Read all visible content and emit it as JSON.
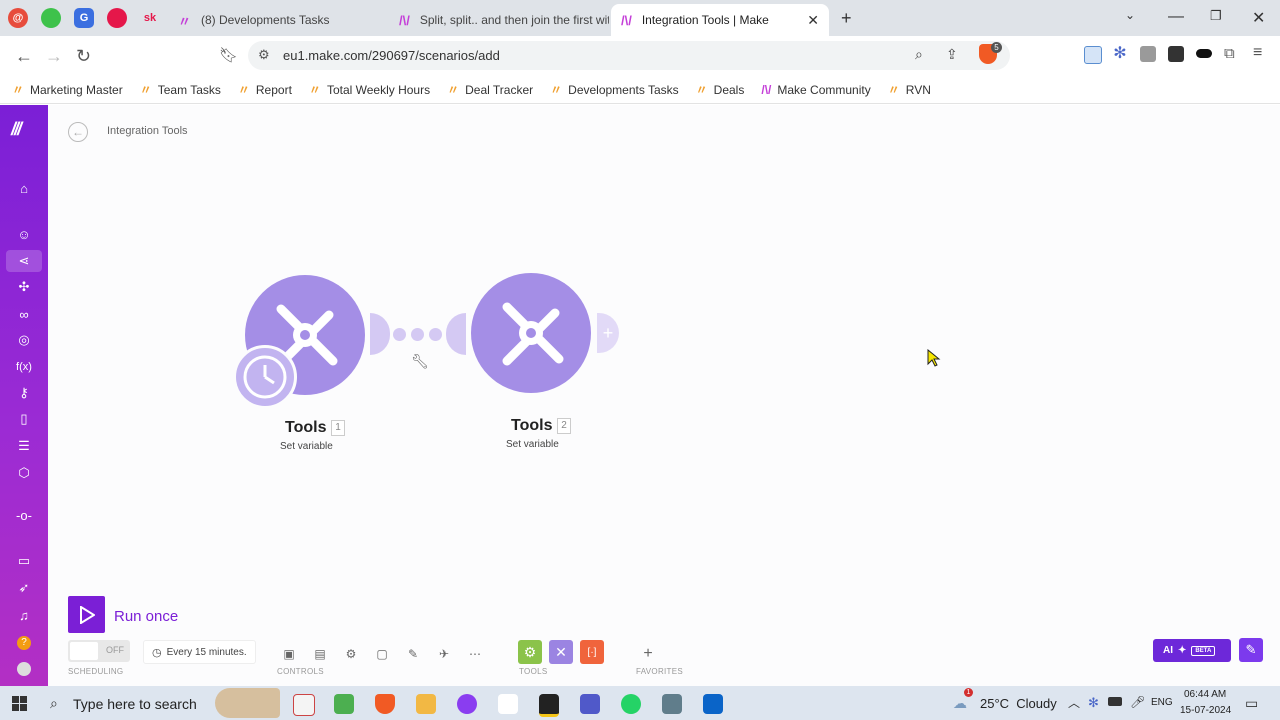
{
  "browser": {
    "tabs": [
      {
        "label": "(8) Developments Tasks",
        "active": false
      },
      {
        "label": "Split, split.. and then join the first wit",
        "active": false
      },
      {
        "label": "Integration Tools | Make",
        "active": true
      }
    ],
    "pinned_tab_text": "sk",
    "new_tab_label": "+",
    "url": "eu1.make.com/290697/scenarios/add",
    "brave_badge": "5"
  },
  "bookmarks": [
    "Marketing Master",
    "Team Tasks",
    "Report",
    "Total Weekly Hours",
    "Deal Tracker",
    "Developments Tasks",
    "Deals",
    "Make Community",
    "RVN"
  ],
  "scenario": {
    "breadcrumb": "Integration Tools",
    "modules": [
      {
        "title": "Tools",
        "number": "1",
        "subtitle": "Set variable"
      },
      {
        "title": "Tools",
        "number": "2",
        "subtitle": "Set variable"
      }
    ],
    "add_symbol": "+"
  },
  "toolbar": {
    "run_once_label": "Run once",
    "toggle_label": "OFF",
    "schedule_text": "Every 15 minutes.",
    "labels": {
      "scheduling": "SCHEDULING",
      "controls": "CONTROLS",
      "tools": "TOOLS",
      "favorites": "FAVORITES"
    },
    "add_favorite": "+",
    "ai_label": "AI",
    "beta_label": "BETA"
  },
  "sidebar": {
    "functions_label": "f(x)"
  },
  "taskbar": {
    "search_placeholder": "Type here to search",
    "weather": "25°C  Cloudy",
    "weather_alert": "1",
    "language": "ENG",
    "time": "06:44 AM",
    "date": "15-07-2024"
  },
  "colors": {
    "brand": "#8a24d6",
    "module": "#a48ee6",
    "run_button": "#7b1fd6",
    "ai_button": "#6d28d9"
  }
}
